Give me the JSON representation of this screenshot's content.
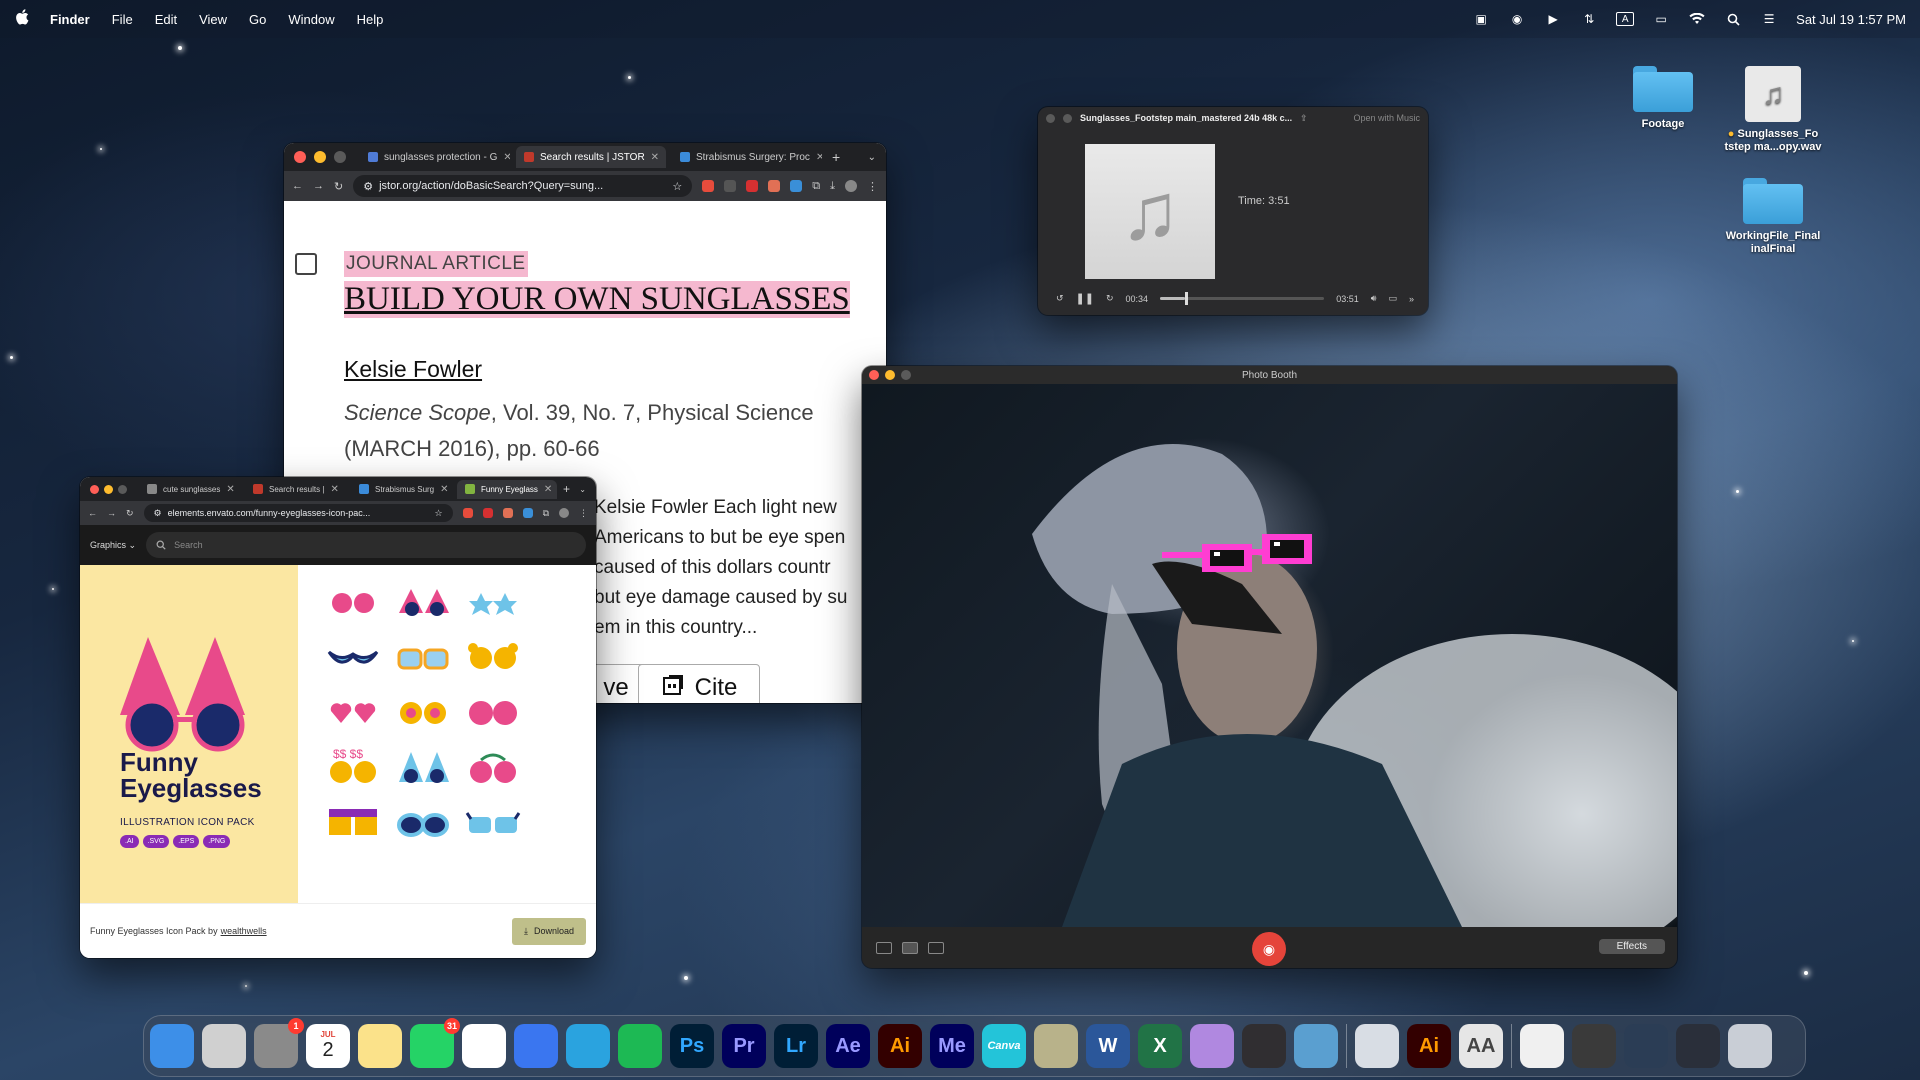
{
  "menubar": {
    "apple": "",
    "items": [
      "Finder",
      "File",
      "Edit",
      "View",
      "Go",
      "Window",
      "Help"
    ],
    "status_icons": [
      "camera-icon",
      "share-icon",
      "play-icon",
      "airdrop-icon",
      "input-icon",
      "battery-icon",
      "wifi-icon",
      "search-icon",
      "control-center-icon"
    ],
    "input_label": "A",
    "datetime": "Sat Jul 19  1:57 PM"
  },
  "jstor_window": {
    "tabs": [
      {
        "label": "sunglasses protection - G",
        "color": "#4f7bd6"
      },
      {
        "label": "Search results | JSTOR",
        "color": "#c0392b"
      },
      {
        "label": "Strabismus Surgery: Proc",
        "color": "#3b8bd9"
      }
    ],
    "url": "jstor.org/action/doBasicSearch?Query=sung...",
    "article": {
      "type": "JOURNAL ARTICLE",
      "title": "BUILD YOUR OWN SUNGLASSES",
      "author": "Kelsie Fowler",
      "journal_name": "Science Scope",
      "journal_rest": ", Vol. 39, No. 7, Physical Science (MARCH 2016), pp. 60-66",
      "snippet": [
        "Kelsie Fowler Each light new",
        "Americans to but be eye spen",
        "caused of this dollars countr",
        "but eye damage caused by su",
        "em in this country..."
      ],
      "save_label": "ve",
      "cite_label": "Cite"
    }
  },
  "music_window": {
    "title": "Sunglasses_Footstep main_mastered 24b 48k c...",
    "open_with": "Open with Music",
    "time_label": "Time: 3:51",
    "elapsed": "00:34",
    "total": "03:51",
    "progress": 0.15
  },
  "photobooth_window": {
    "title": "Photo Booth",
    "effects_label": "Effects"
  },
  "envato_window": {
    "tabs": [
      {
        "label": "cute sunglasses",
        "color": "#888"
      },
      {
        "label": "Search results |",
        "color": "#c0392b"
      },
      {
        "label": "Strabismus Surg",
        "color": "#3b8bd9"
      },
      {
        "label": "Funny Eyeglass",
        "color": "#82b440"
      }
    ],
    "url": "elements.envato.com/funny-eyeglasses-icon-pac...",
    "nav_category": "Graphics",
    "search_placeholder": "Search",
    "product_title_1": "Funny",
    "product_title_2": "Eyeglasses",
    "product_sub": "ILLUSTRATION ICON PACK",
    "formats": [
      ".AI",
      ".SVG",
      ".EPS",
      ".PNG"
    ],
    "footer_text": "Funny Eyeglasses Icon Pack by",
    "footer_author": "wealthwells",
    "download_label": "Download"
  },
  "desktop_icons": [
    {
      "label": "Footage",
      "type": "folder"
    },
    {
      "label": "Sunglasses_Fo tstep ma...opy.wav",
      "type": "audio"
    },
    {
      "label": "WorkingFile_Final inalFinal",
      "type": "folder"
    }
  ],
  "dock": {
    "apps": [
      {
        "name": "finder",
        "label": "",
        "bg": "#3d8fe8"
      },
      {
        "name": "launchpad",
        "label": "",
        "bg": "#d0d0d0"
      },
      {
        "name": "system-settings",
        "label": "",
        "bg": "#8a8a8a",
        "badge": "1"
      },
      {
        "name": "calendar",
        "label": "2",
        "bg": "#ffffff",
        "sub": "JUL"
      },
      {
        "name": "notes",
        "label": "",
        "bg": "#fbe28a"
      },
      {
        "name": "whatsapp",
        "label": "",
        "bg": "#25d366",
        "badge": "31"
      },
      {
        "name": "chrome",
        "label": "",
        "bg": "#ffffff"
      },
      {
        "name": "signal",
        "label": "",
        "bg": "#3a76f0"
      },
      {
        "name": "telegram",
        "label": "",
        "bg": "#2aa3df"
      },
      {
        "name": "spotify",
        "label": "",
        "bg": "#1db954"
      },
      {
        "name": "photoshop",
        "label": "Ps",
        "bg": "#001e36",
        "fg": "#31a8ff"
      },
      {
        "name": "premiere",
        "label": "Pr",
        "bg": "#00005b",
        "fg": "#9999ff"
      },
      {
        "name": "lightroom",
        "label": "Lr",
        "bg": "#001e36",
        "fg": "#31a8ff"
      },
      {
        "name": "after-effects",
        "label": "Ae",
        "bg": "#00005b",
        "fg": "#9999ff"
      },
      {
        "name": "illustrator",
        "label": "Ai",
        "bg": "#330000",
        "fg": "#ff9a00"
      },
      {
        "name": "media-encoder",
        "label": "Me",
        "bg": "#00005b",
        "fg": "#9999ff"
      },
      {
        "name": "canva",
        "label": "Canva",
        "bg": "#23c4d9"
      },
      {
        "name": "davinci",
        "label": "",
        "bg": "#b8b28a"
      },
      {
        "name": "word",
        "label": "W",
        "bg": "#2b579a"
      },
      {
        "name": "excel",
        "label": "X",
        "bg": "#217346"
      },
      {
        "name": "downloads",
        "label": "",
        "bg": "#b088e0"
      },
      {
        "name": "obs",
        "label": "",
        "bg": "#302e31"
      },
      {
        "name": "quicktime",
        "label": "",
        "bg": "#5a9fd0"
      },
      {
        "name": "preview",
        "label": "",
        "bg": "#d8dde4"
      },
      {
        "name": "illustrator-2",
        "label": "Ai",
        "bg": "#330000",
        "fg": "#ff9a00"
      },
      {
        "name": "font-book",
        "label": "AA",
        "bg": "#e6e6e6",
        "fg": "#444"
      },
      {
        "name": "recent-doc-1",
        "label": "",
        "bg": "#f0f0f0"
      },
      {
        "name": "recent-doc-2",
        "label": "",
        "bg": "#3a3a3a"
      },
      {
        "name": "recent-doc-3",
        "label": "",
        "bg": "#2b3d55"
      },
      {
        "name": "recent-doc-4",
        "label": "",
        "bg": "#2a2f3a"
      },
      {
        "name": "trash",
        "label": "",
        "bg": "#c9ced6"
      }
    ]
  }
}
